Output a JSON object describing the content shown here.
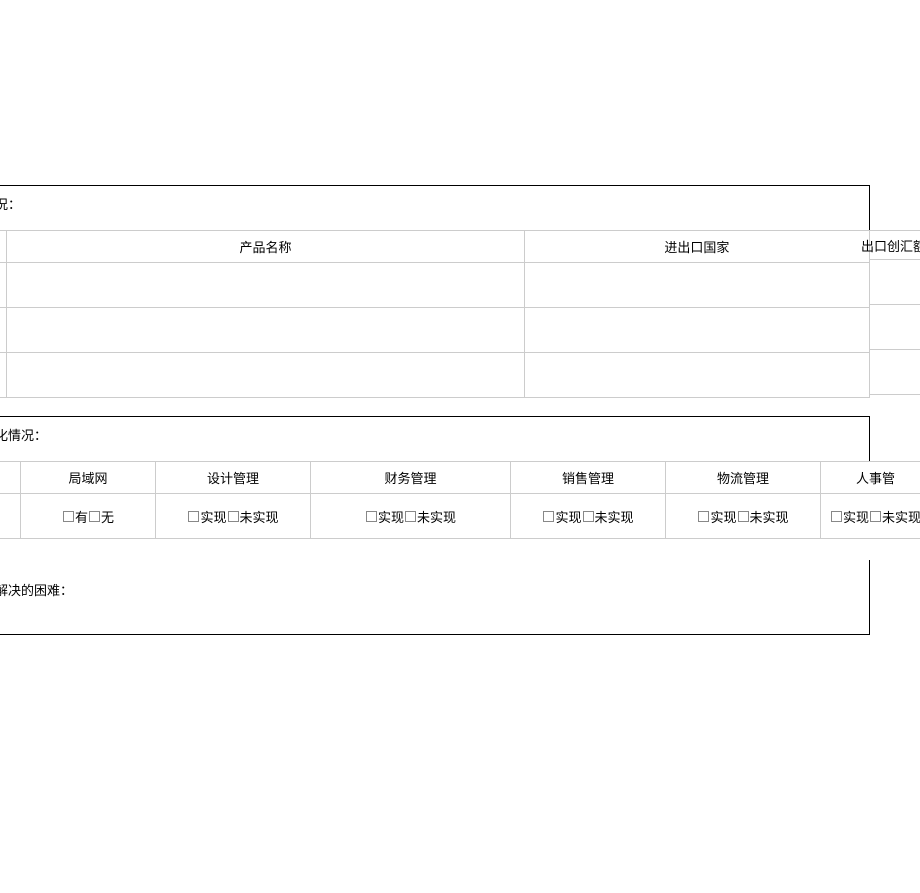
{
  "section1": {
    "label": "况：",
    "headers": {
      "col1": "",
      "product_name": "产品名称",
      "import_export_country": "进出口国家",
      "export_amount_usd": "出口创汇额（美元）"
    },
    "rows": [
      {
        "c1": "",
        "product_name": "",
        "country": ""
      },
      {
        "c1": "",
        "product_name": "",
        "country": ""
      },
      {
        "c1": "",
        "product_name": "",
        "country": ""
      }
    ]
  },
  "section2": {
    "label": "化情况：",
    "headers": {
      "col1": "",
      "lan": "局域网",
      "design_mgmt": "设计管理",
      "finance_mgmt": "财务管理",
      "sales_mgmt": "销售管理",
      "logistics_mgmt": "物流管理",
      "hr_mgmt": "人事管"
    },
    "options": {
      "yes": "有",
      "no": "无",
      "realized": "实现",
      "not_realized": "未实现"
    }
  },
  "section3": {
    "label": "解决的困难："
  }
}
